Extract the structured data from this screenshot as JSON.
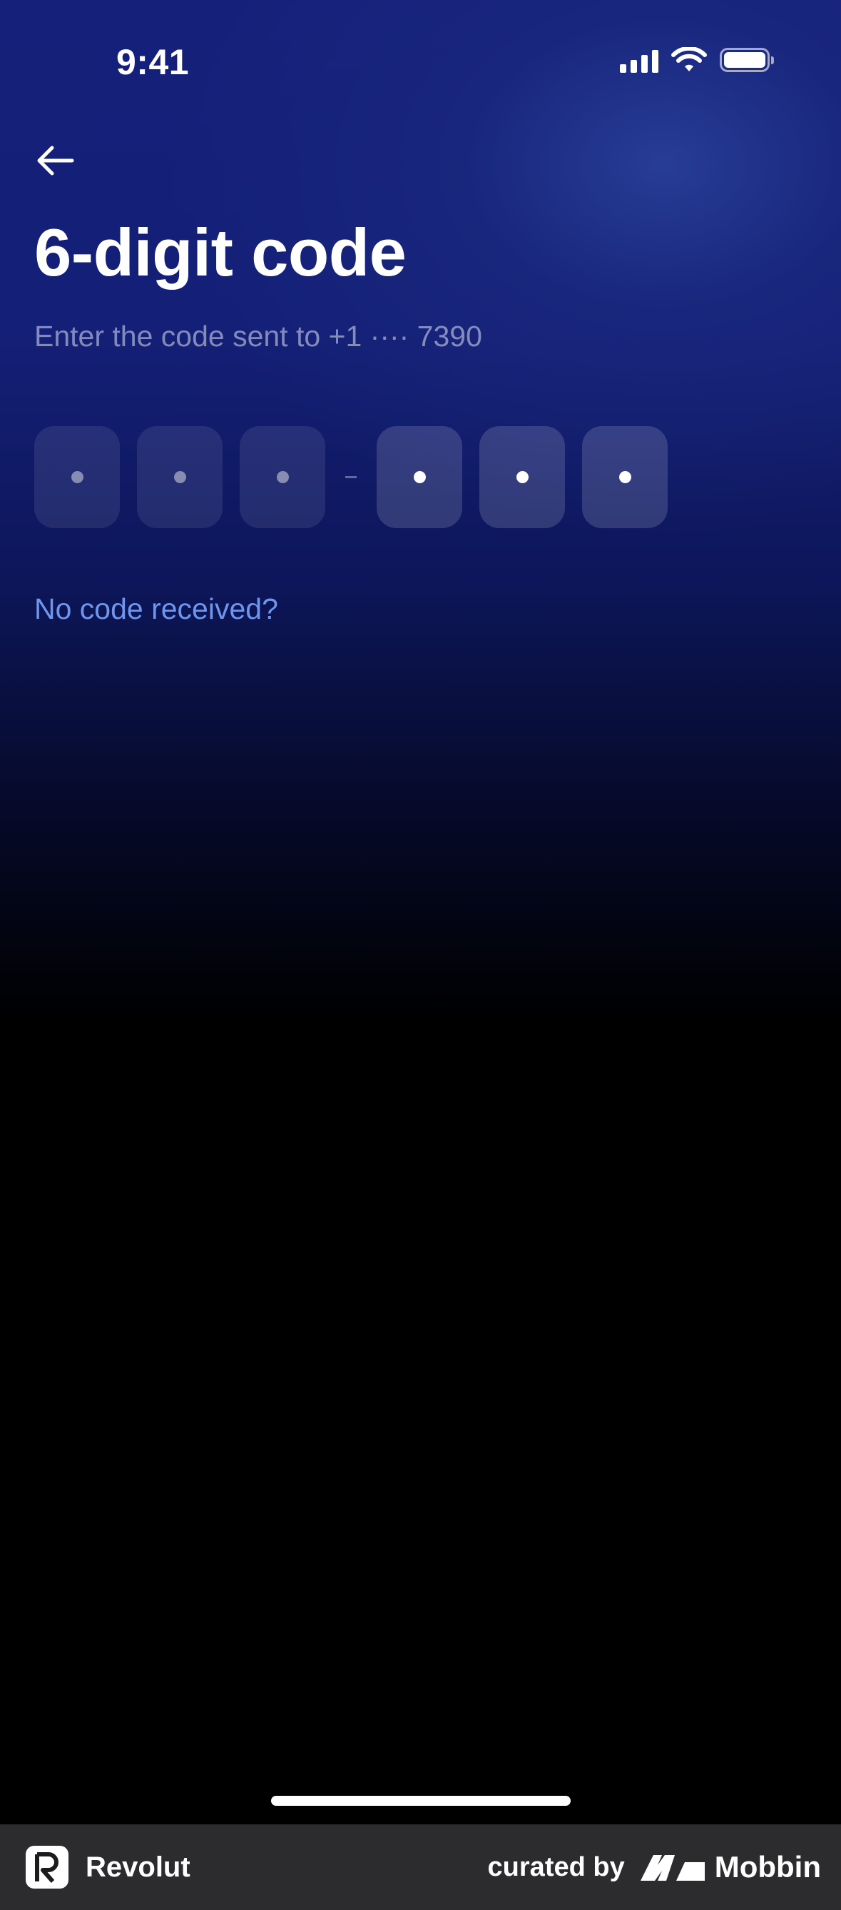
{
  "status_bar": {
    "time": "9:41"
  },
  "header": {
    "back_icon": "arrow-left-icon",
    "title": "6-digit code",
    "subtitle": "Enter the code sent to +1 ···· 7390"
  },
  "code_input": {
    "digits": 6,
    "filled_count": 3,
    "group_separator": "-"
  },
  "links": {
    "resend": "No code received?"
  },
  "footer": {
    "app_name": "Revolut",
    "curated_label": "curated by",
    "brand_name": "Mobbin"
  },
  "colors": {
    "link": "#6f96ef",
    "background_top": "#15207a",
    "background_bottom": "#000000",
    "footer_bg": "#2c2c2e"
  }
}
